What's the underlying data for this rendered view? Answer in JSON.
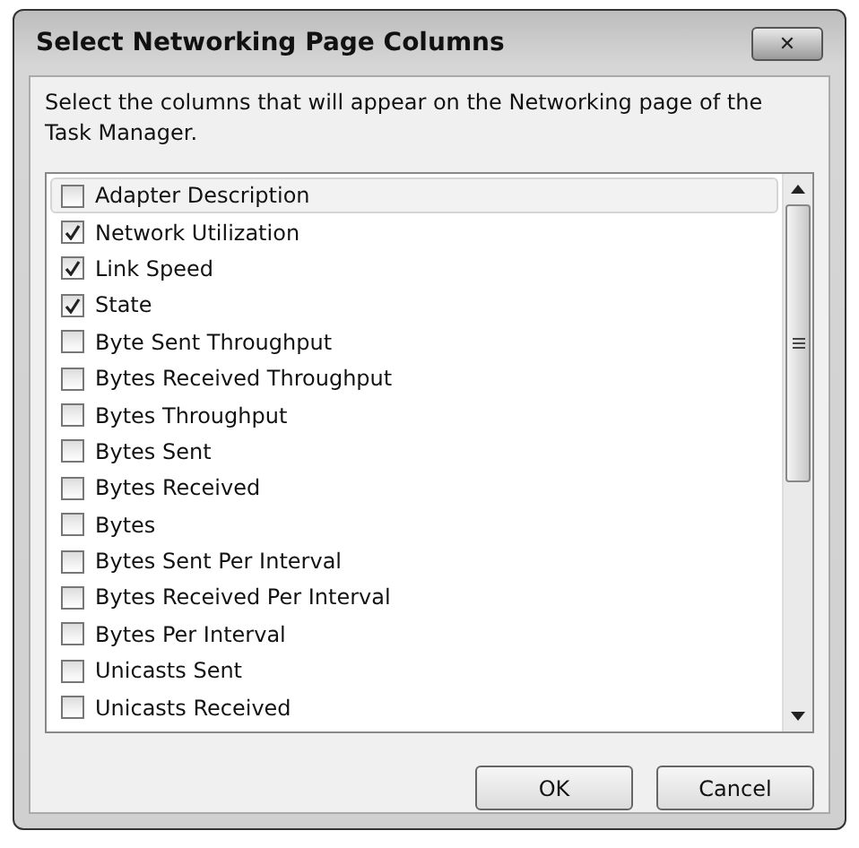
{
  "window": {
    "title": "Select Networking Page Columns",
    "close_label": "✕"
  },
  "description": "Select the columns that will appear on the Networking page of the Task Manager.",
  "columns": [
    {
      "label": "Adapter Description",
      "checked": false,
      "selected": true
    },
    {
      "label": "Network Utilization",
      "checked": true,
      "selected": false
    },
    {
      "label": "Link Speed",
      "checked": true,
      "selected": false
    },
    {
      "label": "State",
      "checked": true,
      "selected": false
    },
    {
      "label": "Byte Sent Throughput",
      "checked": false,
      "selected": false
    },
    {
      "label": "Bytes Received Throughput",
      "checked": false,
      "selected": false
    },
    {
      "label": "Bytes Throughput",
      "checked": false,
      "selected": false
    },
    {
      "label": "Bytes Sent",
      "checked": false,
      "selected": false
    },
    {
      "label": "Bytes Received",
      "checked": false,
      "selected": false
    },
    {
      "label": "Bytes",
      "checked": false,
      "selected": false
    },
    {
      "label": "Bytes Sent Per Interval",
      "checked": false,
      "selected": false
    },
    {
      "label": "Bytes Received Per Interval",
      "checked": false,
      "selected": false
    },
    {
      "label": "Bytes Per Interval",
      "checked": false,
      "selected": false
    },
    {
      "label": "Unicasts Sent",
      "checked": false,
      "selected": false
    },
    {
      "label": "Unicasts Received",
      "checked": false,
      "selected": false
    }
  ],
  "buttons": [
    "OK",
    "Cancel"
  ]
}
